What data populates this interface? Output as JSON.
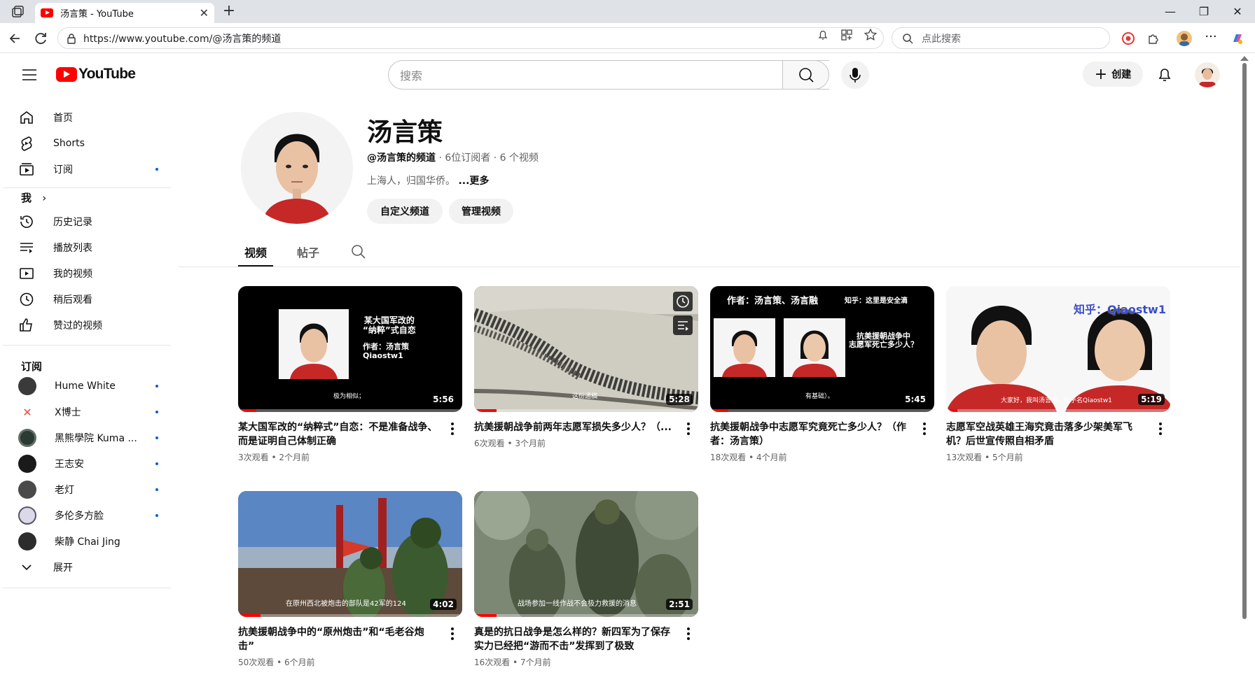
{
  "browser": {
    "tab_title": "汤言策 - YouTube",
    "url": "https://www.youtube.com/@汤言策的频道",
    "search_placeholder": "点此搜索"
  },
  "masthead": {
    "logo_text": "YouTube",
    "search_placeholder": "搜索",
    "create_label": "创建"
  },
  "sidebar": {
    "main": [
      {
        "label": "首页",
        "icon": "home-icon"
      },
      {
        "label": "Shorts",
        "icon": "shorts-icon"
      },
      {
        "label": "订阅",
        "icon": "subscriptions-icon"
      }
    ],
    "you_heading": "我",
    "you_items": [
      {
        "label": "历史记录",
        "icon": "history-icon"
      },
      {
        "label": "播放列表",
        "icon": "playlists-icon"
      },
      {
        "label": "我的视频",
        "icon": "your-videos-icon"
      },
      {
        "label": "稍后观看",
        "icon": "watch-later-icon"
      },
      {
        "label": "赞过的视频",
        "icon": "liked-icon"
      }
    ],
    "subs_heading": "订阅",
    "subscriptions": [
      {
        "label": "Hume White",
        "color": "#3a3a3a"
      },
      {
        "label": "X博士",
        "color": "#e74c3c"
      },
      {
        "label": "黑熊學院 Kuma ...",
        "color": "#2b3a33"
      },
      {
        "label": "王志安",
        "color": "#1a1a1a"
      },
      {
        "label": "老灯",
        "color": "#4a4a4a"
      },
      {
        "label": "多伦多方脸",
        "color": "#d9d9e8"
      },
      {
        "label": "柴静 Chai Jing",
        "color": "#2c2c2c"
      }
    ],
    "expand_label": "展开"
  },
  "channel": {
    "name": "汤言策",
    "handle": "@汤言策的频道",
    "stats": " · 6位订阅者 · 6 个视频",
    "description": "上海人，归国华侨。",
    "more": "...更多",
    "customize_label": "自定义频道",
    "manage_label": "管理视频",
    "tabs": [
      "视频",
      "帖子"
    ]
  },
  "videos": [
    {
      "title": "某大国军改的“纳粹式”自恋：不是准备战争、而是证明自己体制正确",
      "meta": "3次观看 • 2个月前",
      "duration": "5:56",
      "progress": 0.08,
      "thumb_lines": [
        "某大国军改的",
        "“纳粹”式自恋",
        "作者：汤言策",
        "Qiaostw1"
      ],
      "thumb_caption": "极为相似；"
    },
    {
      "title": "抗美援朝战争前两年志愿军损失多少人？（...",
      "meta": "6次观看 • 3个月前",
      "duration": "5:28",
      "progress": 0.1,
      "thumb_caption": "这份通稿"
    },
    {
      "title": "抗美援朝战争中志愿军究竟死亡多少人？（作者：汤言策）",
      "meta": "18次观看 • 4个月前",
      "duration": "5:45",
      "progress": 0.08,
      "thumb_lines": [
        "作者：汤言策、汤言融",
        "知乎：这里是安全滴",
        "抗美援朝战争中",
        "志愿军死亡多少人？"
      ],
      "thumb_caption": "有基础）。"
    },
    {
      "title": "志愿军空战英雄王海究竟击落多少架美军飞机？后世宣传照自相矛盾",
      "meta": "13次观看 • 5个月前",
      "duration": "5:19",
      "progress": 0.05,
      "thumb_lines": [
        "知乎：Qiaostw1"
      ],
      "thumb_caption": "大家好，我叫汤言策，知乎名Qiaostw1"
    },
    {
      "title": "抗美援朝战争中的“原州炮击”和“毛老谷炮击”",
      "meta": "50次观看 • 6个月前",
      "duration": "4:02",
      "progress": 0.1,
      "thumb_caption": "在原州西北被炮击的部队是42军的124"
    },
    {
      "title": "真是的抗日战争是怎么样的？新四军为了保存实力已经把“游而不击”发挥到了极致",
      "meta": "16次观看 • 7个月前",
      "duration": "2:51",
      "progress": 0.1,
      "thumb_caption": "战场参加一线作战不会极力救援的消息"
    }
  ]
}
